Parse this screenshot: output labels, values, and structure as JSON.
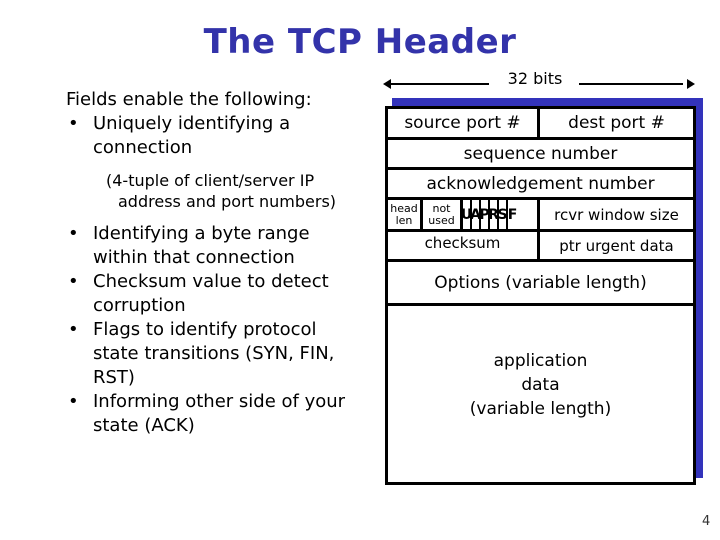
{
  "title": "The TCP Header",
  "left": {
    "intro": "Fields enable the following:",
    "bullets": [
      {
        "text": "Uniquely identifying a connection",
        "sub": "(4-tuple of client/server IP address and port numbers)"
      },
      {
        "text": "Identifying a byte range within that connection"
      },
      {
        "text": "Checksum value to detect corruption"
      },
      {
        "text": "Flags to identify protocol state transitions (SYN, FIN, RST)"
      },
      {
        "text": "Informing other side of your state (ACK)"
      }
    ],
    "bullet_glyph": "•"
  },
  "diagram": {
    "width_label": "32 bits",
    "source_port": "source port #",
    "dest_port": "dest port #",
    "sequence_number": "sequence number",
    "ack_number": "acknowledgement number",
    "head_len": [
      "head",
      "len"
    ],
    "not_used": [
      "not",
      "used"
    ],
    "flags": [
      "U",
      "A",
      "P",
      "R",
      "S",
      "F"
    ],
    "rcvr_window": "rcvr window size",
    "checksum": "checksum",
    "urgent_ptr": "ptr urgent data",
    "options": "Options (variable length)",
    "app_data": [
      "application",
      "data",
      "(variable length)"
    ],
    "colors": {
      "title": "#3333aa",
      "shadow": "#3333bb"
    }
  },
  "page_number": "4"
}
